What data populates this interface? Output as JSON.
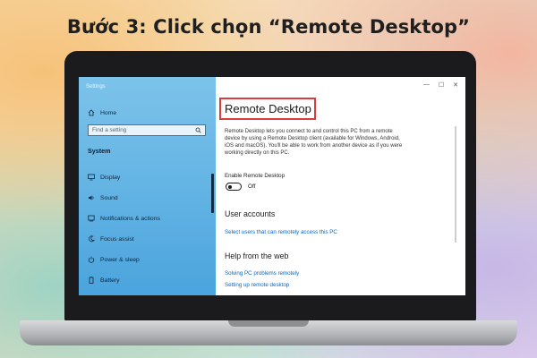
{
  "heading": "Bước 3: Click chọn “Remote Desktop”",
  "settings": {
    "window_title": "Settings",
    "window_controls": [
      "—",
      "☐",
      "✕"
    ],
    "search_placeholder": "Find a setting",
    "home_label": "Home",
    "section_label": "System",
    "nav_items": [
      {
        "label": "Display",
        "icon": "display-icon"
      },
      {
        "label": "Sound",
        "icon": "sound-icon"
      },
      {
        "label": "Notifications & actions",
        "icon": "notifications-icon"
      },
      {
        "label": "Focus assist",
        "icon": "focus-assist-icon"
      },
      {
        "label": "Power & sleep",
        "icon": "power-icon"
      },
      {
        "label": "Battery",
        "icon": "battery-icon"
      }
    ]
  },
  "content": {
    "title": "Remote Desktop",
    "description": "Remote Desktop lets you connect to and control this PC from a remote device by using a Remote Desktop client (available for Windows, Android, iOS and macOS). You'll be able to work from another device as if you were working directly on this PC.",
    "toggle_label": "Enable Remote Desktop",
    "toggle_state": "Off",
    "user_accounts_heading": "User accounts",
    "user_accounts_link": "Select users that can remotely access this PC",
    "help_heading": "Help from the web",
    "help_links": [
      "Solving PC problems remotely",
      "Setting up remote desktop"
    ]
  },
  "colors": {
    "highlight": "#d83c3c",
    "link": "#0b65c2",
    "left_pane": "#5fb1e3"
  }
}
